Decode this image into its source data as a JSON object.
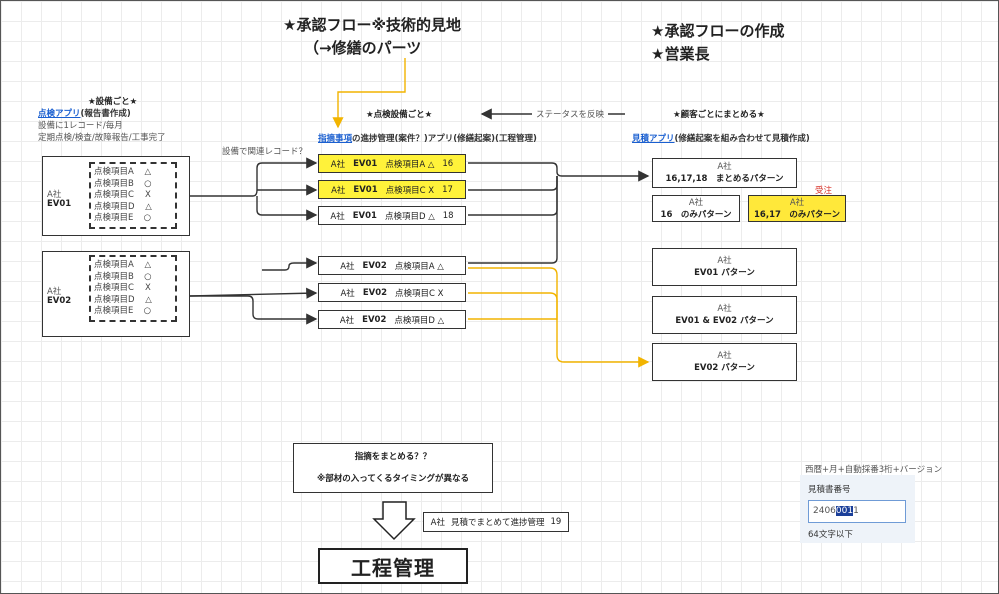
{
  "header": {
    "flow_line1": "★承認フロー※技術的見地",
    "flow_line2": "（→修繕のパーツ",
    "right_line1": "★承認フローの作成",
    "right_line2": "★営業長"
  },
  "left_section": {
    "title": "★設備ごと★",
    "app_link": "点検アプリ",
    "app_suffix": "(報告書作成)",
    "note1": "設備に1レコード/毎月",
    "note2": "定期点検/検査/故障報告/工事完了"
  },
  "equipment": [
    {
      "company": "A社",
      "name": "EV01",
      "items": [
        {
          "label": "点検項目A",
          "mark": "△"
        },
        {
          "label": "点検項目B",
          "mark": "○"
        },
        {
          "label": "点検項目C",
          "mark": "X"
        },
        {
          "label": "点検項目D",
          "mark": "△"
        },
        {
          "label": "点検項目E",
          "mark": "○"
        }
      ]
    },
    {
      "company": "A社",
      "name": "EV02",
      "items": [
        {
          "label": "点検項目A",
          "mark": "△"
        },
        {
          "label": "点検項目B",
          "mark": "○"
        },
        {
          "label": "点検項目C",
          "mark": "X"
        },
        {
          "label": "点検項目D",
          "mark": "△"
        },
        {
          "label": "点検項目E",
          "mark": "○"
        }
      ]
    }
  ],
  "middle_section": {
    "title": "★点検設備ごと★",
    "app_link": "指摘事項",
    "app_suffix": "の進捗管理(案件？)アプリ(修繕起案)(工程管理)",
    "related_note": "設備で関連レコード？",
    "records": [
      {
        "company": "A社",
        "equip": "EV01",
        "item": "点検項目A △",
        "num": "16",
        "highlight": true
      },
      {
        "company": "A社",
        "equip": "EV01",
        "item": "点検項目C X",
        "num": "17",
        "highlight": true
      },
      {
        "company": "A社",
        "equip": "EV01",
        "item": "点検項目D △",
        "num": "18",
        "highlight": false
      },
      {
        "company": "A社",
        "equip": "EV02",
        "item": "点検項目A △",
        "num": "",
        "highlight": false
      },
      {
        "company": "A社",
        "equip": "EV02",
        "item": "点検項目C X",
        "num": "",
        "highlight": false
      },
      {
        "company": "A社",
        "equip": "EV02",
        "item": "点検項目D △",
        "num": "",
        "highlight": false
      }
    ]
  },
  "status_reflect": "ステータスを反映",
  "right_section": {
    "title": "★顧客ごとにまとめる★",
    "app_link": "見積アプリ",
    "app_suffix": "(修繕起案を組み合わせて見積作成)",
    "order_label": "受注",
    "patterns": [
      {
        "company": "A社",
        "label": "16,17,18　まとめるパターン",
        "highlight": false
      },
      {
        "company": "A社",
        "label": "16　のみパターン",
        "highlight": false
      },
      {
        "company": "A社",
        "label": "16,17　のみパターン",
        "highlight": true
      },
      {
        "company": "A社",
        "label": "EV01 パターン",
        "highlight": false
      },
      {
        "company": "A社",
        "label": "EV01 & EV02 パターン",
        "highlight": false
      },
      {
        "company": "A社",
        "label": "EV02 パターン",
        "highlight": false
      }
    ]
  },
  "summary_box": {
    "line1": "指摘をまとめる？？",
    "line2": "※部材の入ってくるタイミングが異なる"
  },
  "progress_box": {
    "company": "A社",
    "text": "見積でまとめて進捗管理",
    "num": "19"
  },
  "process_label": "工程管理",
  "estimate": {
    "format_note": "西暦+月+自動採番3桁+バージョン",
    "field_label": "見積書番号",
    "value_pre": "2406",
    "value_selected": "001",
    "value_post": "1",
    "limit_note": "64文字以下"
  },
  "colors": {
    "highlight": "#fff23a",
    "connector_orange": "#f2b400",
    "link_blue": "#1a5fd0"
  }
}
